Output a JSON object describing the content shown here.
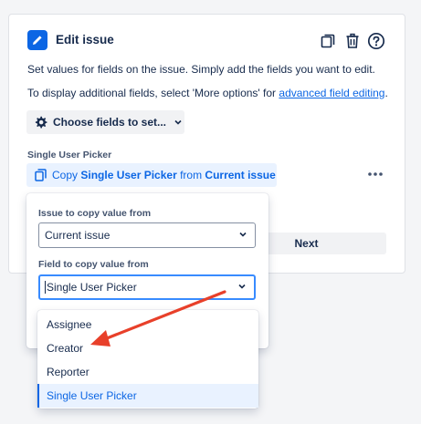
{
  "header": {
    "title": "Edit issue",
    "icons": [
      "pencil-icon",
      "copy-icon",
      "trash-icon",
      "help-icon"
    ]
  },
  "description": {
    "line1": "Set values for fields on the issue. Simply add the fields you want to edit.",
    "line2_prefix": "To display additional fields, select 'More options' for ",
    "line2_link": "advanced field editing",
    "line2_suffix": "."
  },
  "choose_fields": {
    "label": "Choose fields to set..."
  },
  "field": {
    "label": "Single User Picker",
    "copy_prefix": "Copy ",
    "copy_field": "Single User Picker",
    "copy_middle": " from ",
    "copy_source": "Current issue"
  },
  "next_button": "Next",
  "popup": {
    "issue_label": "Issue to copy value from",
    "issue_value": "Current issue",
    "field_label": "Field to copy value from",
    "field_value": "Single User Picker"
  },
  "dropdown": {
    "options": [
      {
        "label": "Assignee",
        "selected": false
      },
      {
        "label": "Creator",
        "selected": false
      },
      {
        "label": "Reporter",
        "selected": false
      },
      {
        "label": "Single User Picker",
        "selected": true
      }
    ]
  },
  "colors": {
    "accent": "#0c66e4",
    "annotation_arrow": "#e8402a",
    "selected_bg": "#e9f2ff"
  }
}
